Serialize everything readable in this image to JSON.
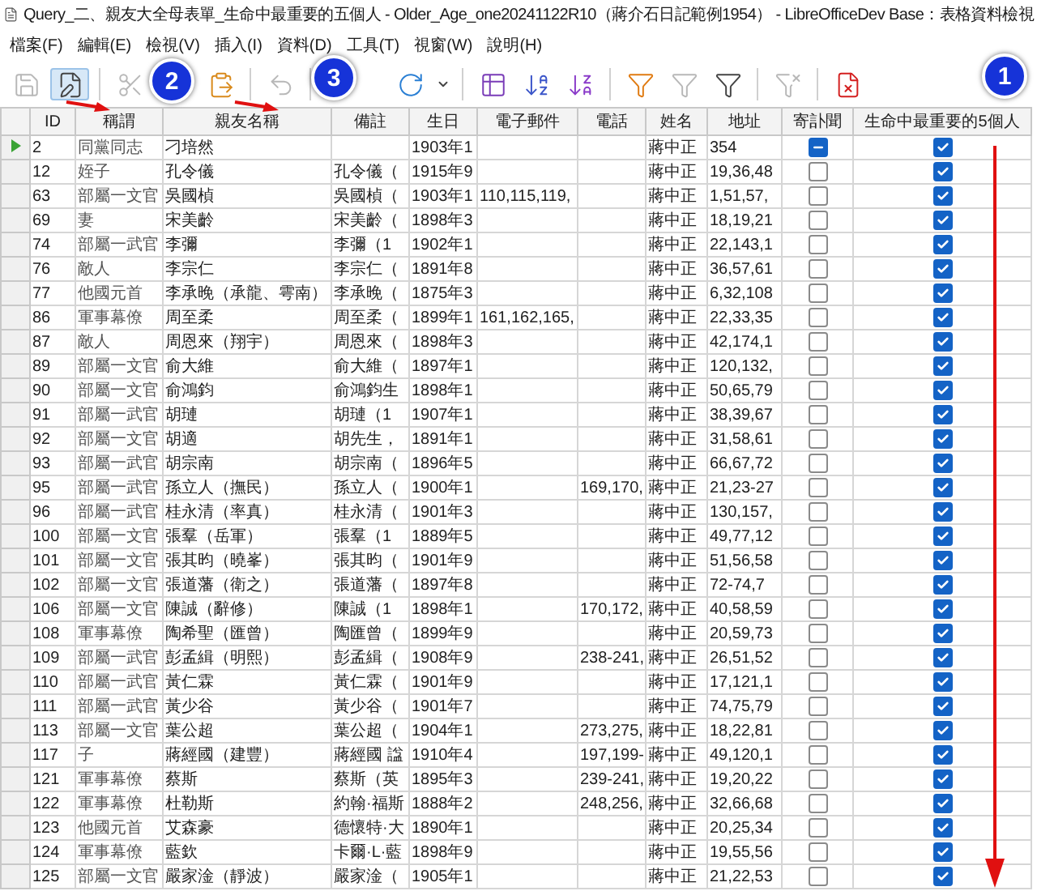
{
  "window": {
    "title": "Query_二、親友大全母表單_生命中最重要的五個人 - Older_Age_one20241122R10（蔣介石日記範例1954） - LibreOfficeDev Base：表格資料檢視"
  },
  "menu": [
    "檔案(F)",
    "編輯(E)",
    "檢視(V)",
    "插入(I)",
    "資料(D)",
    "工具(T)",
    "視窗(W)",
    "說明(H)"
  ],
  "toolbar": [
    {
      "kind": "save",
      "disabled": true,
      "pressed": false
    },
    {
      "kind": "edit",
      "disabled": false,
      "pressed": true
    },
    {
      "kind": "separator"
    },
    {
      "kind": "cut",
      "disabled": true,
      "pressed": false
    },
    {
      "kind": "gap"
    },
    {
      "kind": "paste",
      "disabled": false,
      "pressed": false
    },
    {
      "kind": "separator"
    },
    {
      "kind": "undo",
      "disabled": true,
      "pressed": false
    },
    {
      "kind": "separator"
    },
    {
      "kind": "widegap"
    },
    {
      "kind": "refresh",
      "disabled": false,
      "pressed": false
    },
    {
      "kind": "dropdown",
      "disabled": false,
      "pressed": false
    },
    {
      "kind": "separator"
    },
    {
      "kind": "sortdialog",
      "disabled": false,
      "pressed": false
    },
    {
      "kind": "sortasc",
      "disabled": false,
      "pressed": false
    },
    {
      "kind": "sortdesc",
      "disabled": false,
      "pressed": false
    },
    {
      "kind": "separator"
    },
    {
      "kind": "autofilter",
      "disabled": false,
      "pressed": false
    },
    {
      "kind": "stdfilter",
      "disabled": true,
      "pressed": false
    },
    {
      "kind": "filter",
      "disabled": false,
      "pressed": false
    },
    {
      "kind": "separator"
    },
    {
      "kind": "removefilter",
      "disabled": true,
      "pressed": false
    },
    {
      "kind": "separator"
    },
    {
      "kind": "delete",
      "disabled": false,
      "pressed": false
    }
  ],
  "annotations": [
    {
      "label": "2"
    },
    {
      "label": "3"
    },
    {
      "label": "1"
    }
  ],
  "table": {
    "columns": [
      "ID",
      "稱謂",
      "親友名稱",
      "備註",
      "生日",
      "電子郵件",
      "電話",
      "姓名",
      "地址",
      "寄訃聞",
      "生命中最重要的5個人"
    ],
    "rows": [
      {
        "current": true,
        "id": "2",
        "relation": "同黨同志",
        "name": "刁培然",
        "birth": "1903年1",
        "person": "蔣中正",
        "pages": "354",
        "obituary_unset": true,
        "important": true
      },
      {
        "current": false,
        "id": "12",
        "relation": "姪子",
        "name": "孔令儀",
        "note": "孔令儀（",
        "birth": "1915年9",
        "person": "蔣中正",
        "pages": "19,36,48",
        "obituary": false,
        "obituary_unset": false,
        "important": true
      },
      {
        "current": false,
        "id": "63",
        "relation": "部屬一文官",
        "name": "吳國楨",
        "note": "吳國楨（",
        "birth": "1903年1",
        "email": "110,115,119,",
        "person": "蔣中正",
        "pages": "1,51,57,",
        "obituary": false,
        "obituary_unset": false,
        "important": true
      },
      {
        "current": false,
        "id": "69",
        "relation": "妻",
        "name": "宋美齡",
        "note": "宋美齡（",
        "birth": "1898年3",
        "person": "蔣中正",
        "pages": "18,19,21",
        "obituary": false,
        "obituary_unset": false,
        "important": true
      },
      {
        "current": false,
        "id": "74",
        "relation": "部屬一武官",
        "name": "李彌",
        "note": "李彌（1",
        "birth": "1902年1",
        "person": "蔣中正",
        "pages": "22,143,1",
        "obituary": false,
        "obituary_unset": false,
        "important": true
      },
      {
        "current": false,
        "id": "76",
        "relation": "敵人",
        "name": "李宗仁",
        "note": "李宗仁（",
        "birth": "1891年8",
        "person": "蔣中正",
        "pages": "36,57,61",
        "obituary": false,
        "obituary_unset": false,
        "important": true
      },
      {
        "current": false,
        "id": "77",
        "relation": "他國元首",
        "name": "李承晚（承龍、雩南）",
        "note": "李承晚（",
        "birth": "1875年3",
        "person": "蔣中正",
        "pages": "6,32,108",
        "obituary": false,
        "obituary_unset": false,
        "important": true
      },
      {
        "current": false,
        "id": "86",
        "relation": "軍事幕僚",
        "name": "周至柔",
        "note": "周至柔（",
        "birth": "1899年1",
        "email": "161,162,165,",
        "person": "蔣中正",
        "pages": "22,33,35",
        "obituary": false,
        "obituary_unset": false,
        "important": true
      },
      {
        "current": false,
        "id": "87",
        "relation": "敵人",
        "name": "周恩來（翔宇）",
        "note": "周恩來（",
        "birth": "1898年3",
        "person": "蔣中正",
        "pages": "42,174,1",
        "obituary": false,
        "obituary_unset": false,
        "important": true
      },
      {
        "current": false,
        "id": "89",
        "relation": "部屬一文官",
        "name": "俞大維",
        "note": "俞大維（",
        "birth": "1897年1",
        "person": "蔣中正",
        "pages": "120,132,",
        "obituary": false,
        "obituary_unset": false,
        "important": true
      },
      {
        "current": false,
        "id": "90",
        "relation": "部屬一文官",
        "name": "俞鴻鈞",
        "note": "俞鴻鈞生",
        "birth": "1898年1",
        "person": "蔣中正",
        "pages": "50,65,79",
        "obituary": false,
        "obituary_unset": false,
        "important": true
      },
      {
        "current": false,
        "id": "91",
        "relation": "部屬一武官",
        "name": "胡璉",
        "note": "胡璉（1",
        "birth": "1907年1",
        "person": "蔣中正",
        "pages": "38,39,67",
        "obituary": false,
        "obituary_unset": false,
        "important": true
      },
      {
        "current": false,
        "id": "92",
        "relation": "部屬一文官",
        "name": "胡適",
        "note": "胡先生，",
        "birth": "1891年1",
        "person": "蔣中正",
        "pages": "31,58,61",
        "obituary": false,
        "obituary_unset": false,
        "important": true
      },
      {
        "current": false,
        "id": "93",
        "relation": "部屬一武官",
        "name": "胡宗南",
        "note": "胡宗南（",
        "birth": "1896年5",
        "person": "蔣中正",
        "pages": "66,67,72",
        "obituary": false,
        "obituary_unset": false,
        "important": true
      },
      {
        "current": false,
        "id": "95",
        "relation": "部屬一武官",
        "name": "孫立人（撫民）",
        "note": "孫立人（",
        "birth": "1900年1",
        "phone": "169,170,",
        "person": "蔣中正",
        "pages": "21,23-27",
        "obituary": false,
        "obituary_unset": false,
        "important": true
      },
      {
        "current": false,
        "id": "96",
        "relation": "部屬一武官",
        "name": "桂永清（率真）",
        "note": "桂永清（",
        "birth": "1901年3",
        "person": "蔣中正",
        "pages": "130,157,",
        "obituary": false,
        "obituary_unset": false,
        "important": true
      },
      {
        "current": false,
        "id": "100",
        "relation": "部屬一文官",
        "name": "張羣（岳軍）",
        "note": "張羣（1",
        "birth": "1889年5",
        "person": "蔣中正",
        "pages": "49,77,12",
        "obituary": false,
        "obituary_unset": false,
        "important": true
      },
      {
        "current": false,
        "id": "101",
        "relation": "部屬一文官",
        "name": "張其昀（曉峯）",
        "note": "張其昀（",
        "birth": "1901年9",
        "person": "蔣中正",
        "pages": "51,56,58",
        "obituary": false,
        "obituary_unset": false,
        "important": true
      },
      {
        "current": false,
        "id": "102",
        "relation": "部屬一文官",
        "name": "張道藩（衛之）",
        "note": "張道藩（",
        "birth": "1897年8",
        "person": "蔣中正",
        "pages": "72-74,7",
        "obituary": false,
        "obituary_unset": false,
        "important": true
      },
      {
        "current": false,
        "id": "106",
        "relation": "部屬一文官",
        "name": "陳誠（辭修）",
        "note": "陳誠（1",
        "birth": "1898年1",
        "phone": "170,172,",
        "person": "蔣中正",
        "pages": "40,58,59",
        "obituary": false,
        "obituary_unset": false,
        "important": true
      },
      {
        "current": false,
        "id": "108",
        "relation": "軍事幕僚",
        "name": "陶希聖（匯曾）",
        "note": "陶匯曾（",
        "birth": "1899年9",
        "person": "蔣中正",
        "pages": "20,59,73",
        "obituary": false,
        "obituary_unset": false,
        "important": true
      },
      {
        "current": false,
        "id": "109",
        "relation": "部屬一武官",
        "name": "彭孟緝（明熙）",
        "note": "彭孟緝（",
        "birth": "1908年9",
        "phone": "238-241,",
        "person": "蔣中正",
        "pages": "26,51,52",
        "obituary": false,
        "obituary_unset": false,
        "important": true
      },
      {
        "current": false,
        "id": "110",
        "relation": "部屬一武官",
        "name": "黃仁霖",
        "note": "黃仁霖（",
        "birth": "1901年9",
        "person": "蔣中正",
        "pages": "17,121,1",
        "obituary": false,
        "obituary_unset": false,
        "important": true
      },
      {
        "current": false,
        "id": "111",
        "relation": "部屬一武官",
        "name": "黃少谷",
        "note": "黃少谷（",
        "birth": "1901年7",
        "person": "蔣中正",
        "pages": "74,75,79",
        "obituary": false,
        "obituary_unset": false,
        "important": true
      },
      {
        "current": false,
        "id": "113",
        "relation": "部屬一文官",
        "name": "葉公超",
        "note": "葉公超（",
        "birth": "1904年1",
        "phone": "273,275,",
        "person": "蔣中正",
        "pages": "18,22,81",
        "obituary": false,
        "obituary_unset": false,
        "important": true
      },
      {
        "current": false,
        "id": "117",
        "relation": "子",
        "name": "蔣經國（建豐）",
        "note": "蔣經國 諡",
        "birth": "1910年4",
        "phone": "197,199-",
        "person": "蔣中正",
        "pages": "49,120,1",
        "obituary": false,
        "obituary_unset": false,
        "important": true
      },
      {
        "current": false,
        "id": "121",
        "relation": "軍事幕僚",
        "name": "蔡斯",
        "note": "蔡斯（英",
        "birth": "1895年3",
        "phone": "239-241,",
        "person": "蔣中正",
        "pages": "19,20,22",
        "obituary": false,
        "obituary_unset": false,
        "important": true
      },
      {
        "current": false,
        "id": "122",
        "relation": "軍事幕僚",
        "name": "杜勒斯",
        "note": "約翰·福斯",
        "birth": "1888年2",
        "phone": "248,256,",
        "person": "蔣中正",
        "pages": "32,66,68",
        "obituary": false,
        "obituary_unset": false,
        "important": true
      },
      {
        "current": false,
        "id": "123",
        "relation": "他國元首",
        "name": "艾森豪",
        "note": "德懷特·大",
        "birth": "1890年1",
        "person": "蔣中正",
        "pages": "20,25,34",
        "obituary": false,
        "obituary_unset": false,
        "important": true
      },
      {
        "current": false,
        "id": "124",
        "relation": "軍事幕僚",
        "name": "藍欽",
        "note": "卡爾·L·藍",
        "birth": "1898年9",
        "person": "蔣中正",
        "pages": "19,55,56",
        "obituary": false,
        "obituary_unset": false,
        "important": true
      },
      {
        "current": false,
        "id": "125",
        "relation": "部屬一文官",
        "name": "嚴家淦（靜波）",
        "note": "嚴家淦（",
        "birth": "1905年1",
        "person": "蔣中正",
        "pages": "21,22,53",
        "obituary": false,
        "obituary_unset": false,
        "important": true
      }
    ]
  }
}
